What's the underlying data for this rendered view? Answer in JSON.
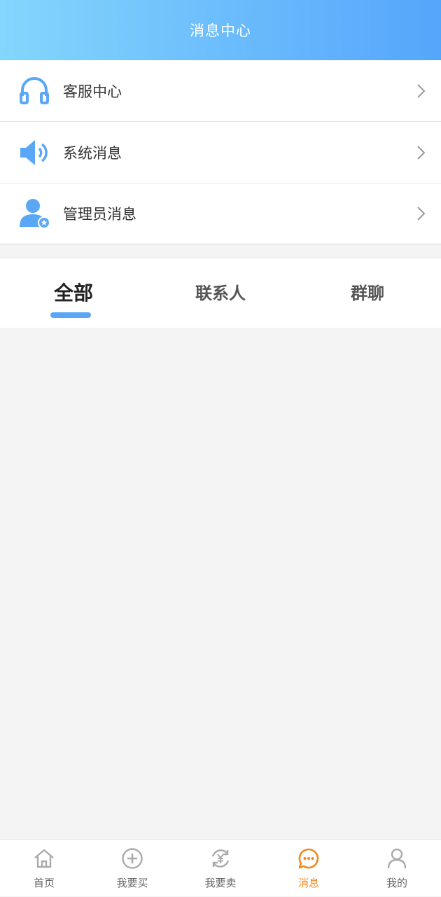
{
  "header": {
    "title": "消息中心"
  },
  "menu": {
    "items": [
      {
        "label": "客服中心",
        "icon": "headset-icon"
      },
      {
        "label": "系统消息",
        "icon": "speaker-icon"
      },
      {
        "label": "管理员消息",
        "icon": "admin-user-icon"
      }
    ]
  },
  "tabs": {
    "items": [
      {
        "label": "全部",
        "active": true
      },
      {
        "label": "联系人",
        "active": false
      },
      {
        "label": "群聊",
        "active": false
      }
    ]
  },
  "bottom_nav": {
    "items": [
      {
        "label": "首页",
        "icon": "home-icon",
        "active": false
      },
      {
        "label": "我要买",
        "icon": "plus-circle-icon",
        "active": false
      },
      {
        "label": "我要卖",
        "icon": "yen-exchange-icon",
        "active": false
      },
      {
        "label": "消息",
        "icon": "chat-bubble-icon",
        "active": true
      },
      {
        "label": "我的",
        "icon": "person-icon",
        "active": false
      }
    ]
  },
  "colors": {
    "accent_blue": "#5aa8f5",
    "active_orange": "#f08b1c",
    "header_gradient_start": "#85d6fd",
    "header_gradient_end": "#55a5fb"
  }
}
